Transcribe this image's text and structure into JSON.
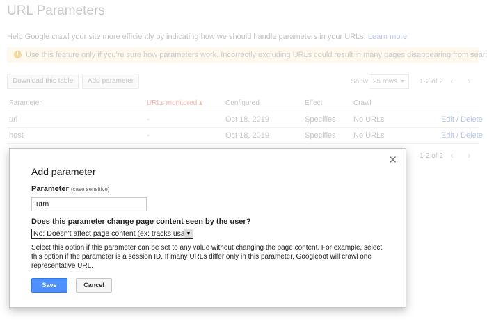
{
  "page": {
    "title": "URL Parameters",
    "help_text": "Help Google crawl your site more efficiently by indicating how we should handle parameters in your URLs.",
    "learn_more": "Learn more",
    "warning": "Use this feature only if you're sure how parameters work. Incorrectly excluding URLs could result in many pages disappearing from search.",
    "warning_icon": "!"
  },
  "toolbar": {
    "download_label": "Download this table",
    "add_label": "Add parameter",
    "show_label": "Show",
    "rows_value": "25 rows",
    "range_text": "1-2 of 2"
  },
  "table": {
    "headers": {
      "parameter": "Parameter",
      "urls_monitored": "URLs monitored ▴",
      "configured": "Configured",
      "effect": "Effect",
      "crawl": "Crawl"
    },
    "rows": [
      {
        "parameter": "url",
        "urls_monitored": "-",
        "configured": "Oct 18, 2019",
        "effect": "Specifies",
        "crawl": "No URLs",
        "actions": "Edit / Delete"
      },
      {
        "parameter": "host",
        "urls_monitored": "-",
        "configured": "Oct 18, 2019",
        "effect": "Specifies",
        "crawl": "No URLs",
        "actions": "Edit / Delete"
      }
    ],
    "bottom_range_text": "1-2 of 2"
  },
  "dialog": {
    "title": "Add parameter",
    "close": "✕",
    "param_label": "Parameter",
    "param_hint": "(case sensitive)",
    "param_value": "utm",
    "question": "Does this parameter change page content seen by the user?",
    "select_value": "No: Doesn't affect page content (ex: tracks usage)",
    "description": "Select this option if this parameter can be set to any value without changing the page content. For example, select this option if the parameter is a session ID. If many URLs differ only in this parameter, Googlebot will crawl one representative URL.",
    "save_label": "Save",
    "cancel_label": "Cancel"
  },
  "colors": {
    "primary_button": "#4d90fe",
    "link": "#1155cc",
    "warning_bg": "#fef9ec"
  }
}
